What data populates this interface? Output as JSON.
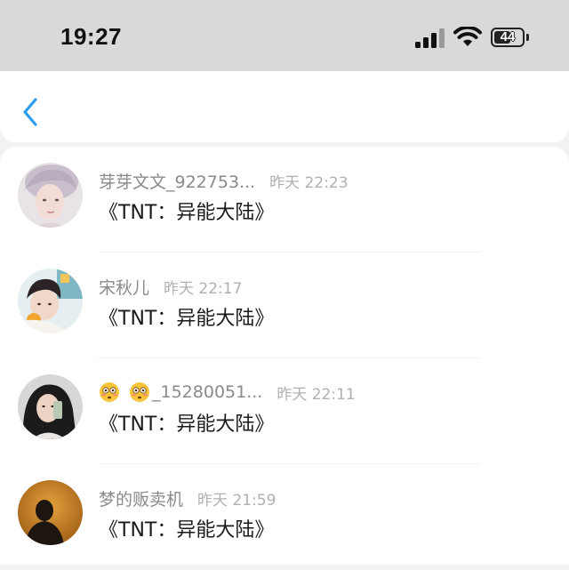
{
  "status_bar": {
    "time": "19:27",
    "battery": "44"
  },
  "nav": {
    "back_icon": "chevron-left-icon",
    "accent_color": "#2a9ff0"
  },
  "items": [
    {
      "username": "芽芽文文_922753...",
      "time": "昨天 22:23",
      "message": "《TNT：异能大陆》"
    },
    {
      "username": "宋秋儿",
      "time": "昨天 22:17",
      "message": "《TNT：异能大陆》"
    },
    {
      "username_emojis": [
        "flushed-face-emoji",
        "flushed-face-emoji"
      ],
      "username": "_15280051...",
      "time": "昨天 22:11",
      "message": "《TNT：异能大陆》"
    },
    {
      "username": "梦的贩卖机",
      "time": "昨天 21:59",
      "message": "《TNT：异能大陆》"
    }
  ]
}
